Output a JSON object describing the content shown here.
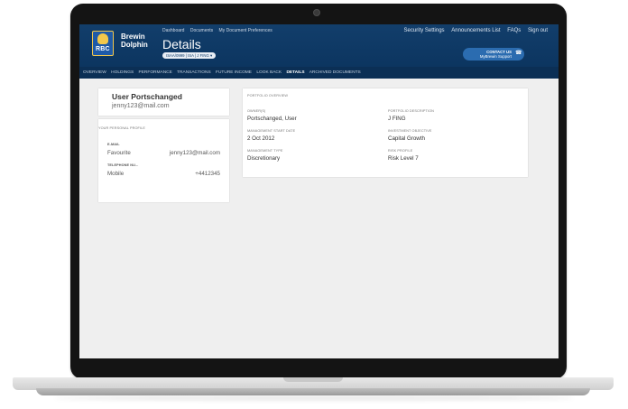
{
  "brand": {
    "name_line1": "Brewin",
    "name_line2": "Dolphin",
    "logo_text": "RBC"
  },
  "header": {
    "top_links": [
      "Dashboard",
      "Documents",
      "My Document Preferences"
    ],
    "title": "Details",
    "account_selector": "ISAA/0999 | ISA | J FING ▾",
    "right_links": [
      "Security Settings",
      "Announcements List",
      "FAQs",
      "Sign out"
    ],
    "contact_label": "CONTACT US",
    "contact_sub": "MyBrewin Support"
  },
  "nav": {
    "items": [
      "OVERVIEW",
      "HOLDINGS",
      "PERFORMANCE",
      "TRANSACTIONS",
      "FUTURE INCOME",
      "LOOK BACK",
      "DETAILS",
      "ARCHIVED DOCUMENTS"
    ],
    "active": "DETAILS"
  },
  "profile": {
    "name": "User Portschanged",
    "email": "jenny123@mail.com"
  },
  "personal_profile": {
    "title": "YOUR PERSONAL PROFILE",
    "email_label": "E-MAIL",
    "email_type": "Favourite",
    "email_value": "jenny123@mail.com",
    "phone_label": "TELEPHONE NU...",
    "phone_type": "Mobile",
    "phone_value": "+4412345"
  },
  "portfolio_overview": {
    "title": "PORTFOLIO OVERVIEW",
    "owners_label": "OWNER(S)",
    "owners_value": "Portschanged, User",
    "start_date_label": "MANAGEMENT START DATE",
    "start_date_value": "2 Oct 2012",
    "mgmt_type_label": "MANAGEMENT TYPE",
    "mgmt_type_value": "Discretionary",
    "description_label": "PORTFOLIO DESCRIPTION",
    "description_value": "J FING",
    "objective_label": "INVESTMENT OBJECTIVE",
    "objective_value": "Capital Growth",
    "risk_label": "RISK PROFILE",
    "risk_value": "Risk Level 7"
  }
}
